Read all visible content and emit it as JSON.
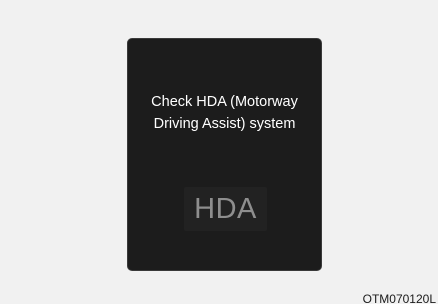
{
  "display": {
    "message_line_1": "Check HDA (Motorway",
    "message_line_2": "Driving Assist) system",
    "indicator_label": "HDA"
  },
  "figure_code": "OTM070120L",
  "colors": {
    "background": "#f1f1f1",
    "panel": "#1c1c1c",
    "message_text": "#ffffff",
    "indicator_text": "#8e8e8e"
  },
  "icons": {
    "indicator": "hda-indicator-icon"
  }
}
